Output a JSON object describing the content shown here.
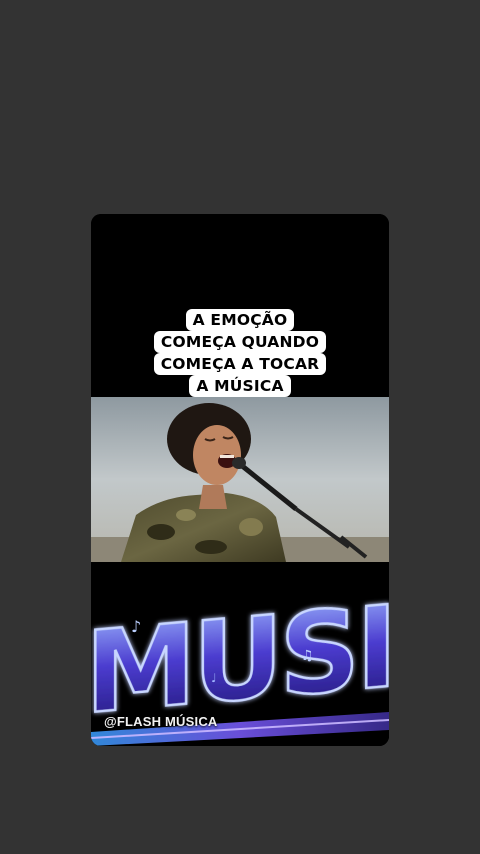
{
  "caption": {
    "lines": [
      "A EMOÇÃO",
      "COMEÇA QUANDO",
      "COMEÇA A TOCAR",
      "A MÚSICA"
    ]
  },
  "banner": {
    "word": "MUSIC"
  },
  "watermark": {
    "text": "@FLASH MÚSICA"
  },
  "colors": {
    "background": "#333333",
    "caption_bg": "#ffffff",
    "caption_text": "#000000",
    "music_glow": "#6a5cff"
  }
}
